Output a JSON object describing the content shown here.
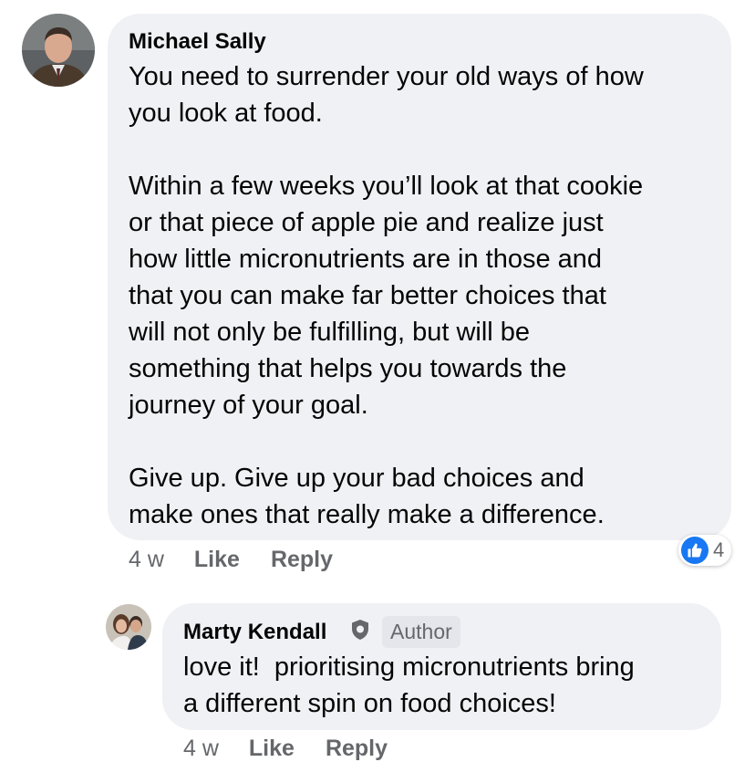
{
  "comments": [
    {
      "author": "Michael Sally",
      "text": "You need to surrender your old ways of how\nyou look at food.\n\nWithin a few weeks you’ll look at that cookie\nor that piece of apple pie and realize just\nhow little micronutrients are in those and\nthat you can make far better choices that\nwill not only be fulfilling, but will be\nsomething that helps you towards the\njourney of your goal.\n\nGive up. Give up your bad choices and\nmake ones that really make a difference.",
      "time": "4 w",
      "like_label": "Like",
      "reply_label": "Reply",
      "reaction_count": "4",
      "reaction_icon": "like-icon"
    }
  ],
  "reply": {
    "author": "Marty Kendall",
    "badge": "Author",
    "badge_icon": "shield-icon",
    "text": "love it!  prioritising micronutrients bring\na different spin on food choices!",
    "time": "4 w",
    "like_label": "Like",
    "reply_label": "Reply"
  },
  "colors": {
    "bubble": "#f0f1f5",
    "meta_text": "#65676b",
    "like_blue": "#1877f2"
  }
}
